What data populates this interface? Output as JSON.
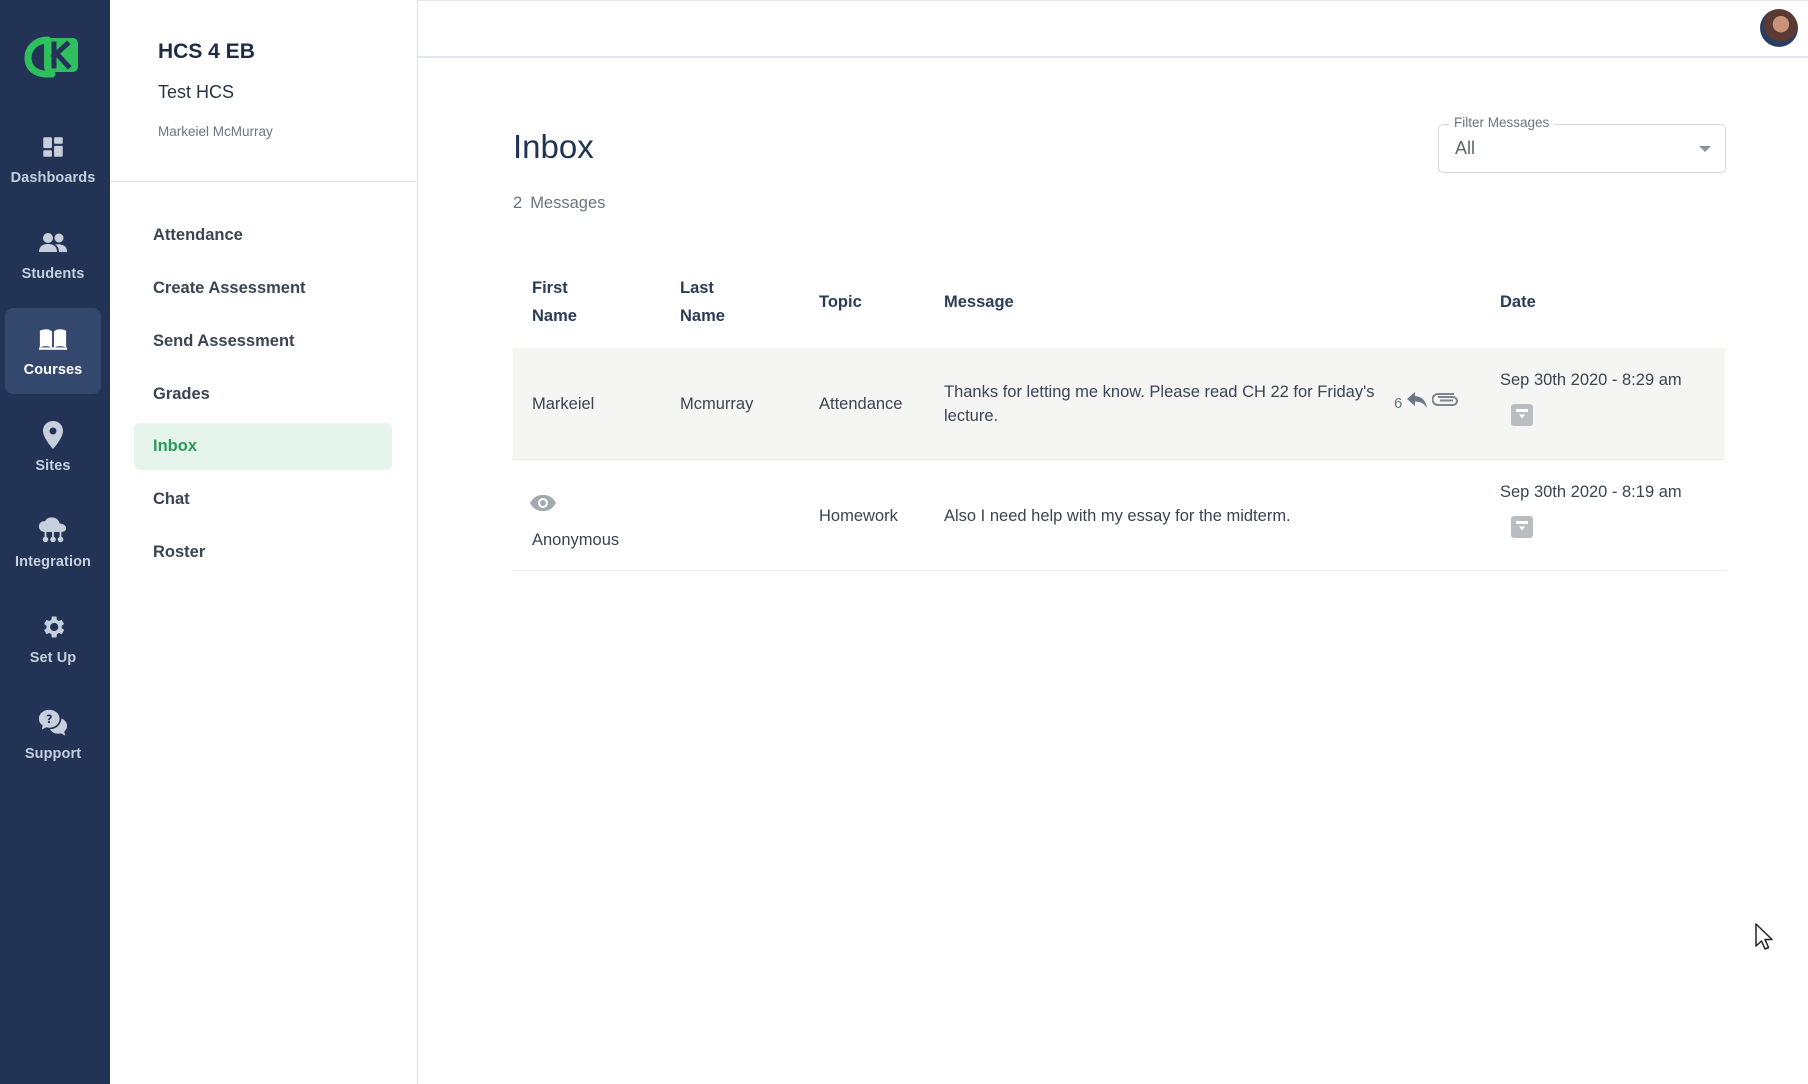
{
  "rail": {
    "items": [
      {
        "label": "Dashboards",
        "icon": "dashboard-icon"
      },
      {
        "label": "Students",
        "icon": "people-icon"
      },
      {
        "label": "Courses",
        "icon": "book-icon"
      },
      {
        "label": "Sites",
        "icon": "location-pin-icon"
      },
      {
        "label": "Integration",
        "icon": "cloud-network-icon"
      },
      {
        "label": "Set Up",
        "icon": "gear-icon"
      },
      {
        "label": "Support",
        "icon": "help-chat-icon"
      }
    ],
    "active": "Courses"
  },
  "course": {
    "title": "HCS 4 EB",
    "subtitle": "Test HCS",
    "instructor": "Markeiel McMurray"
  },
  "nav": {
    "items": [
      {
        "label": "Attendance"
      },
      {
        "label": "Create Assessment"
      },
      {
        "label": "Send Assessment"
      },
      {
        "label": "Grades"
      },
      {
        "label": "Inbox"
      },
      {
        "label": "Chat"
      },
      {
        "label": "Roster"
      }
    ],
    "active": "Inbox"
  },
  "main": {
    "title": "Inbox",
    "count": "2",
    "count_label": "Messages",
    "filter": {
      "label": "Filter Messages",
      "value": "All"
    }
  },
  "table": {
    "headers": {
      "first_name": [
        "First",
        "Name"
      ],
      "last_name": [
        "Last",
        "Name"
      ],
      "topic": "Topic",
      "message": "Message",
      "date": "Date"
    },
    "rows": [
      {
        "first_name": "Markeiel",
        "last_name": "Mcmurray",
        "topic": "Attendance",
        "message": "Thanks for letting me know. Please read CH 22 for Friday's lecture.",
        "reply_count": "6",
        "date": "Sep 30th 2020 - 8:29 am"
      },
      {
        "first_name": "Anonymous",
        "last_name": "",
        "topic": "Homework",
        "message": "Also I need help with my essay for the midterm.",
        "date": "Sep 30th 2020 - 8:19 am"
      }
    ]
  },
  "colors": {
    "rail_bg": "#233356",
    "rail_active": "#34476d",
    "accent_green": "#2a9a58",
    "nav_active_bg": "#e6f5ec",
    "row_highlight": "#f5f5f4"
  }
}
